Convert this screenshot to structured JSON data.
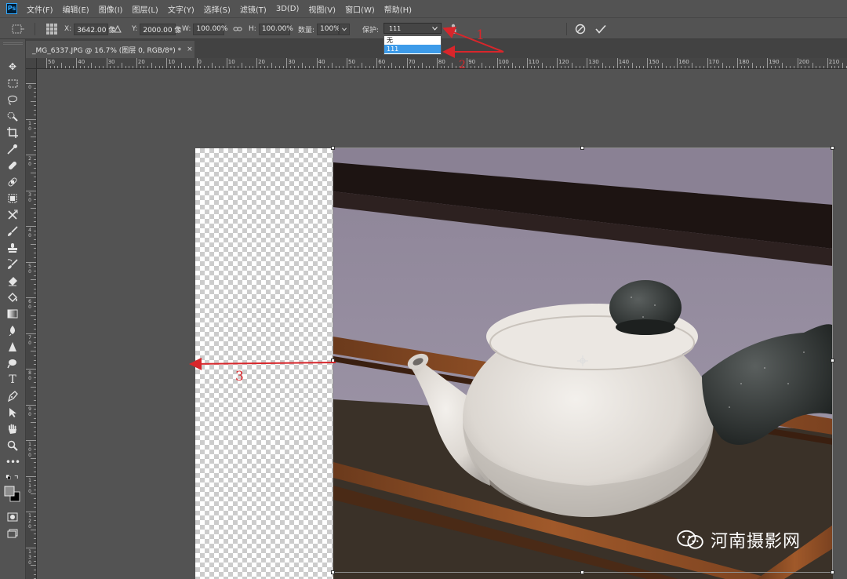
{
  "app": {
    "logo": "Ps"
  },
  "menu": [
    "文件(F)",
    "编辑(E)",
    "图像(I)",
    "图层(L)",
    "文字(Y)",
    "选择(S)",
    "滤镜(T)",
    "3D(D)",
    "视图(V)",
    "窗口(W)",
    "帮助(H)"
  ],
  "options": {
    "x_label": "X:",
    "x_value": "3642.00 像",
    "y_label": "Y:",
    "y_value": "2000.00 像",
    "w_label": "W:",
    "w_value": "100.00%",
    "h_label": "H:",
    "h_value": "100.00%",
    "amount_label": "数量:",
    "amount_value": "100%",
    "protect_label": "保护:",
    "protect_value": "111",
    "protect_options": [
      "无",
      "111"
    ],
    "protect_selected": "111"
  },
  "document": {
    "tab_title": "_MG_6337.JPG @ 16.7% (图层 0, RGB/8*) *",
    "close_glyph": "×"
  },
  "rulers": {
    "horizontal_labels": [
      "50",
      "40",
      "30",
      "20",
      "10",
      "0",
      "10",
      "20",
      "30",
      "40",
      "50",
      "60",
      "70",
      "80",
      "90",
      "100",
      "110",
      "120",
      "130",
      "140",
      "150",
      "160",
      "170",
      "180",
      "190",
      "200",
      "210"
    ],
    "vertical_labels": [
      "0",
      "1 0",
      "2 0",
      "3 0",
      "4 0",
      "5 0",
      "6 0",
      "7 0",
      "8 0",
      "9 0",
      "1 0 0",
      "1 1 0",
      "1 2 0",
      "1 3 0"
    ]
  },
  "annotations": {
    "label_1": "1",
    "label_2": "2",
    "label_3": "3",
    "color": "#d8262b"
  },
  "watermark": {
    "text": "河南摄影网"
  },
  "icons": [
    "ps-logo-icon",
    "move-icon",
    "marquee-icon",
    "lasso-icon",
    "quick-select-icon",
    "crop-icon",
    "eyedropper-icon",
    "healing-brush-icon",
    "patch-icon",
    "content-aware-move-icon",
    "brush-icon",
    "clone-stamp-icon",
    "history-brush-icon",
    "eraser-icon",
    "paint-bucket-icon",
    "gradient-icon",
    "blur-icon",
    "sharpen-icon",
    "dodge-icon",
    "type-icon",
    "pen-icon",
    "path-select-icon",
    "hand-icon",
    "zoom-icon",
    "more-tools-icon",
    "cancel-icon",
    "commit-icon",
    "link-icon",
    "triangle-icon",
    "person-protect-icon"
  ]
}
